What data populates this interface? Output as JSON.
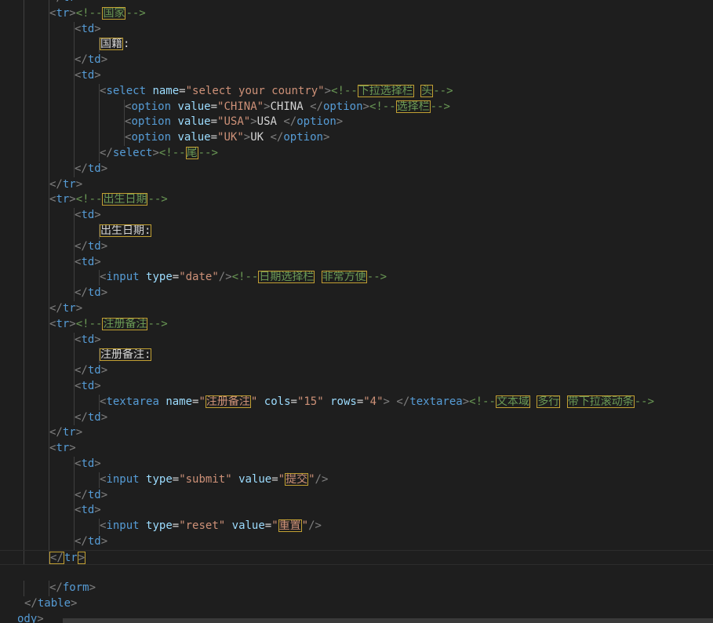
{
  "editor": {
    "lines": [
      {
        "indent": 2,
        "segs": [
          [
            "p",
            "</"
          ],
          [
            "t",
            "tr"
          ],
          [
            "p",
            ">"
          ]
        ]
      },
      {
        "indent": 2,
        "segs": [
          [
            "p",
            "<"
          ],
          [
            "t",
            "tr"
          ],
          [
            "p",
            ">"
          ],
          [
            "c",
            "<!--"
          ],
          [
            "cu",
            "国家"
          ],
          [
            "c",
            "-->"
          ]
        ]
      },
      {
        "indent": 3,
        "segs": [
          [
            "p",
            "<"
          ],
          [
            "t",
            "td"
          ],
          [
            "p",
            ">"
          ]
        ]
      },
      {
        "indent": 4,
        "segs": [
          [
            "xu",
            "国籍"
          ],
          [
            "x",
            ":"
          ]
        ]
      },
      {
        "indent": 3,
        "segs": [
          [
            "p",
            "</"
          ],
          [
            "t",
            "td"
          ],
          [
            "p",
            ">"
          ]
        ]
      },
      {
        "indent": 3,
        "segs": [
          [
            "p",
            "<"
          ],
          [
            "t",
            "td"
          ],
          [
            "p",
            ">"
          ]
        ]
      },
      {
        "indent": 4,
        "segs": [
          [
            "p",
            "<"
          ],
          [
            "t",
            "select"
          ],
          [
            "x",
            " "
          ],
          [
            "a",
            "name"
          ],
          [
            "x",
            "="
          ],
          [
            "s",
            "\"select your country\""
          ],
          [
            "p",
            ">"
          ],
          [
            "c",
            "<!--"
          ],
          [
            "cu",
            "下拉选择栏"
          ],
          [
            "c",
            " "
          ],
          [
            "cu",
            "头"
          ],
          [
            "c",
            "-->"
          ]
        ]
      },
      {
        "indent": 5,
        "segs": [
          [
            "p",
            "<"
          ],
          [
            "t",
            "option"
          ],
          [
            "x",
            " "
          ],
          [
            "a",
            "value"
          ],
          [
            "x",
            "="
          ],
          [
            "s",
            "\"CHINA\""
          ],
          [
            "p",
            ">"
          ],
          [
            "x",
            "CHINA "
          ],
          [
            "p",
            "</"
          ],
          [
            "t",
            "option"
          ],
          [
            "p",
            ">"
          ],
          [
            "c",
            "<!--"
          ],
          [
            "cu",
            "选择栏"
          ],
          [
            "c",
            "-->"
          ]
        ]
      },
      {
        "indent": 5,
        "segs": [
          [
            "p",
            "<"
          ],
          [
            "t",
            "option"
          ],
          [
            "x",
            " "
          ],
          [
            "a",
            "value"
          ],
          [
            "x",
            "="
          ],
          [
            "s",
            "\"USA\""
          ],
          [
            "p",
            ">"
          ],
          [
            "x",
            "USA "
          ],
          [
            "p",
            "</"
          ],
          [
            "t",
            "option"
          ],
          [
            "p",
            ">"
          ]
        ]
      },
      {
        "indent": 5,
        "segs": [
          [
            "p",
            "<"
          ],
          [
            "t",
            "option"
          ],
          [
            "x",
            " "
          ],
          [
            "a",
            "value"
          ],
          [
            "x",
            "="
          ],
          [
            "s",
            "\"UK\""
          ],
          [
            "p",
            ">"
          ],
          [
            "x",
            "UK "
          ],
          [
            "p",
            "</"
          ],
          [
            "t",
            "option"
          ],
          [
            "p",
            ">"
          ]
        ]
      },
      {
        "indent": 4,
        "segs": [
          [
            "p",
            "</"
          ],
          [
            "t",
            "select"
          ],
          [
            "p",
            ">"
          ],
          [
            "c",
            "<!--"
          ],
          [
            "cu",
            "尾"
          ],
          [
            "c",
            "-->"
          ]
        ]
      },
      {
        "indent": 3,
        "segs": [
          [
            "p",
            "</"
          ],
          [
            "t",
            "td"
          ],
          [
            "p",
            ">"
          ]
        ]
      },
      {
        "indent": 2,
        "segs": [
          [
            "p",
            "</"
          ],
          [
            "t",
            "tr"
          ],
          [
            "p",
            ">"
          ]
        ]
      },
      {
        "indent": 2,
        "segs": [
          [
            "p",
            "<"
          ],
          [
            "t",
            "tr"
          ],
          [
            "p",
            ">"
          ],
          [
            "c",
            "<!--"
          ],
          [
            "cu",
            "出生日期"
          ],
          [
            "c",
            "-->"
          ]
        ]
      },
      {
        "indent": 3,
        "segs": [
          [
            "p",
            "<"
          ],
          [
            "t",
            "td"
          ],
          [
            "p",
            ">"
          ]
        ]
      },
      {
        "indent": 4,
        "segs": [
          [
            "xu",
            "出生日期:"
          ]
        ]
      },
      {
        "indent": 3,
        "segs": [
          [
            "p",
            "</"
          ],
          [
            "t",
            "td"
          ],
          [
            "p",
            ">"
          ]
        ]
      },
      {
        "indent": 3,
        "segs": [
          [
            "p",
            "<"
          ],
          [
            "t",
            "td"
          ],
          [
            "p",
            ">"
          ]
        ]
      },
      {
        "indent": 4,
        "segs": [
          [
            "p",
            "<"
          ],
          [
            "t",
            "input"
          ],
          [
            "x",
            " "
          ],
          [
            "a",
            "type"
          ],
          [
            "x",
            "="
          ],
          [
            "s",
            "\"date\""
          ],
          [
            "p",
            "/>"
          ],
          [
            "c",
            "<!--"
          ],
          [
            "cu",
            "日期选择栏"
          ],
          [
            "c",
            " "
          ],
          [
            "cu",
            "非常方便"
          ],
          [
            "c",
            "-->"
          ]
        ]
      },
      {
        "indent": 3,
        "segs": [
          [
            "p",
            "</"
          ],
          [
            "t",
            "td"
          ],
          [
            "p",
            ">"
          ]
        ]
      },
      {
        "indent": 2,
        "segs": [
          [
            "p",
            "</"
          ],
          [
            "t",
            "tr"
          ],
          [
            "p",
            ">"
          ]
        ]
      },
      {
        "indent": 2,
        "segs": [
          [
            "p",
            "<"
          ],
          [
            "t",
            "tr"
          ],
          [
            "p",
            ">"
          ],
          [
            "c",
            "<!--"
          ],
          [
            "cu",
            "注册备注"
          ],
          [
            "c",
            "-->"
          ]
        ]
      },
      {
        "indent": 3,
        "segs": [
          [
            "p",
            "<"
          ],
          [
            "t",
            "td"
          ],
          [
            "p",
            ">"
          ]
        ]
      },
      {
        "indent": 4,
        "segs": [
          [
            "xu",
            "注册备注:"
          ]
        ]
      },
      {
        "indent": 3,
        "segs": [
          [
            "p",
            "</"
          ],
          [
            "t",
            "td"
          ],
          [
            "p",
            ">"
          ]
        ]
      },
      {
        "indent": 3,
        "segs": [
          [
            "p",
            "<"
          ],
          [
            "t",
            "td"
          ],
          [
            "p",
            ">"
          ]
        ]
      },
      {
        "indent": 4,
        "segs": [
          [
            "p",
            "<"
          ],
          [
            "t",
            "textarea"
          ],
          [
            "x",
            " "
          ],
          [
            "a",
            "name"
          ],
          [
            "x",
            "="
          ],
          [
            "s",
            "\""
          ],
          [
            "su",
            "注册备注"
          ],
          [
            "s",
            "\""
          ],
          [
            "x",
            " "
          ],
          [
            "a",
            "cols"
          ],
          [
            "x",
            "="
          ],
          [
            "s",
            "\"15\""
          ],
          [
            "x",
            " "
          ],
          [
            "a",
            "rows"
          ],
          [
            "x",
            "="
          ],
          [
            "s",
            "\"4\""
          ],
          [
            "p",
            ">"
          ],
          [
            "x",
            " "
          ],
          [
            "p",
            "</"
          ],
          [
            "t",
            "textarea"
          ],
          [
            "p",
            ">"
          ],
          [
            "c",
            "<!--"
          ],
          [
            "cu",
            "文本域"
          ],
          [
            "c",
            " "
          ],
          [
            "cu",
            "多行"
          ],
          [
            "c",
            " "
          ],
          [
            "cu",
            "带下拉滚动条"
          ],
          [
            "c",
            "-->"
          ]
        ]
      },
      {
        "indent": 3,
        "segs": [
          [
            "p",
            "</"
          ],
          [
            "t",
            "td"
          ],
          [
            "p",
            ">"
          ]
        ]
      },
      {
        "indent": 2,
        "segs": [
          [
            "p",
            "</"
          ],
          [
            "t",
            "tr"
          ],
          [
            "p",
            ">"
          ]
        ]
      },
      {
        "indent": 2,
        "segs": [
          [
            "p",
            "<"
          ],
          [
            "t",
            "tr"
          ],
          [
            "p",
            ">"
          ]
        ]
      },
      {
        "indent": 3,
        "segs": [
          [
            "p",
            "<"
          ],
          [
            "t",
            "td"
          ],
          [
            "p",
            ">"
          ]
        ]
      },
      {
        "indent": 4,
        "segs": [
          [
            "p",
            "<"
          ],
          [
            "t",
            "input"
          ],
          [
            "x",
            " "
          ],
          [
            "a",
            "type"
          ],
          [
            "x",
            "="
          ],
          [
            "s",
            "\"submit\""
          ],
          [
            "x",
            " "
          ],
          [
            "a",
            "value"
          ],
          [
            "x",
            "="
          ],
          [
            "s",
            "\""
          ],
          [
            "su",
            "提交"
          ],
          [
            "s",
            "\""
          ],
          [
            "p",
            "/>"
          ]
        ]
      },
      {
        "indent": 3,
        "segs": [
          [
            "p",
            "</"
          ],
          [
            "t",
            "td"
          ],
          [
            "p",
            ">"
          ]
        ]
      },
      {
        "indent": 3,
        "segs": [
          [
            "p",
            "<"
          ],
          [
            "t",
            "td"
          ],
          [
            "p",
            ">"
          ]
        ]
      },
      {
        "indent": 4,
        "segs": [
          [
            "p",
            "<"
          ],
          [
            "t",
            "input"
          ],
          [
            "x",
            " "
          ],
          [
            "a",
            "type"
          ],
          [
            "x",
            "="
          ],
          [
            "s",
            "\"reset\""
          ],
          [
            "x",
            " "
          ],
          [
            "a",
            "value"
          ],
          [
            "x",
            "="
          ],
          [
            "s",
            "\""
          ],
          [
            "su",
            "重置"
          ],
          [
            "s",
            "\""
          ],
          [
            "p",
            "/>"
          ]
        ]
      },
      {
        "indent": 3,
        "segs": [
          [
            "p",
            "</"
          ],
          [
            "t",
            "td"
          ],
          [
            "p",
            ">"
          ]
        ]
      },
      {
        "indent": 2,
        "current": true,
        "segs": [
          [
            "pu",
            "</"
          ],
          [
            "t",
            "tr"
          ],
          [
            "pu",
            ">"
          ]
        ]
      },
      {
        "indent": 0,
        "segs": []
      },
      {
        "indent": 2,
        "segs": [
          [
            "p",
            "</"
          ],
          [
            "t",
            "form"
          ],
          [
            "p",
            ">"
          ]
        ]
      },
      {
        "indent": 1,
        "segs": [
          [
            "p",
            "</"
          ],
          [
            "t",
            "table"
          ],
          [
            "p",
            ">"
          ]
        ]
      },
      {
        "indent": 0,
        "segs": [
          [
            "t",
            "ody"
          ],
          [
            "p",
            ">"
          ]
        ]
      }
    ]
  },
  "colors": {
    "background": "#1e1e1e",
    "tag": "#569cd6",
    "attribute": "#9cdcfe",
    "string": "#ce9178",
    "comment": "#6a9955",
    "text": "#d4d4d4",
    "unicode_highlight": "#c2a033"
  }
}
